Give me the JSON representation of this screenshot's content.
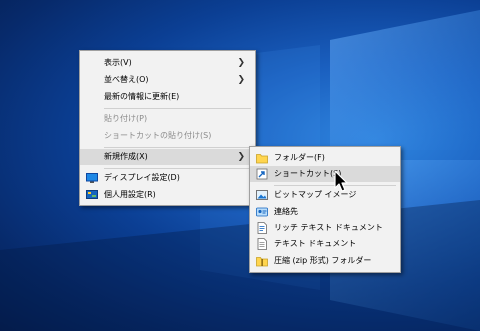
{
  "context_menu": {
    "items": [
      {
        "label": "表示(V)",
        "submenu": true
      },
      {
        "label": "並べ替え(O)",
        "submenu": true
      },
      {
        "label": "最新の情報に更新(E)"
      },
      {
        "label": "貼り付け(P)",
        "disabled": true
      },
      {
        "label": "ショートカットの貼り付け(S)",
        "disabled": true
      },
      {
        "label": "新規作成(X)",
        "submenu": true,
        "highlighted": true
      },
      {
        "label": "ディスプレイ設定(D)",
        "icon": "display-icon"
      },
      {
        "label": "個人用設定(R)",
        "icon": "personalize-icon"
      }
    ]
  },
  "new_submenu": {
    "items": [
      {
        "label": "フォルダー(F)",
        "icon": "folder-icon"
      },
      {
        "label": "ショートカット(S)",
        "icon": "shortcut-icon",
        "highlighted": true
      },
      {
        "label": "ビットマップ イメージ",
        "icon": "bitmap-icon"
      },
      {
        "label": "連絡先",
        "icon": "contact-icon"
      },
      {
        "label": "リッチ テキスト ドキュメント",
        "icon": "rtf-document-icon"
      },
      {
        "label": "テキスト ドキュメント",
        "icon": "text-document-icon"
      },
      {
        "label": "圧縮 (zip 形式) フォルダー",
        "icon": "zip-folder-icon"
      }
    ]
  },
  "colors": {
    "desktop_accent": "#1a5fbf",
    "menu_background": "#f2f2f2",
    "highlight": "#dadada"
  }
}
